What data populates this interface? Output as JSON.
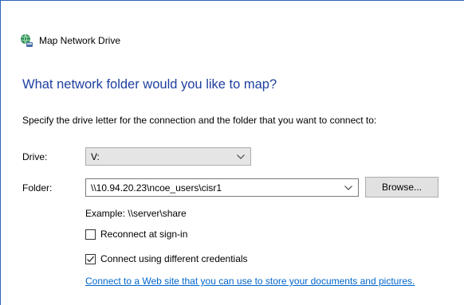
{
  "dialog": {
    "title": "Map Network Drive",
    "heading": "What network folder would you like to map?",
    "instruction": "Specify the drive letter for the connection and the folder that you want to connect to:"
  },
  "form": {
    "drive_label": "Drive:",
    "drive_value": "V:",
    "folder_label": "Folder:",
    "folder_value": "\\\\10.94.20.23\\ncoe_users\\cisr1",
    "browse_label": "Browse...",
    "example_text": "Example: \\\\server\\share"
  },
  "options": {
    "reconnect_label": "Reconnect at sign-in",
    "reconnect_checked": false,
    "credentials_label": "Connect using different credentials",
    "credentials_checked": true,
    "web_link": "Connect to a Web site that you can use to store your documents and pictures."
  },
  "icons": {
    "title": "network-drive-icon",
    "dropdown": "chevron-down-icon",
    "check": "checkmark-icon"
  },
  "colors": {
    "heading": "#1e3f9f",
    "link": "#0066cc",
    "window_border": "#2b66b7",
    "button_face": "#e1e1e1"
  }
}
